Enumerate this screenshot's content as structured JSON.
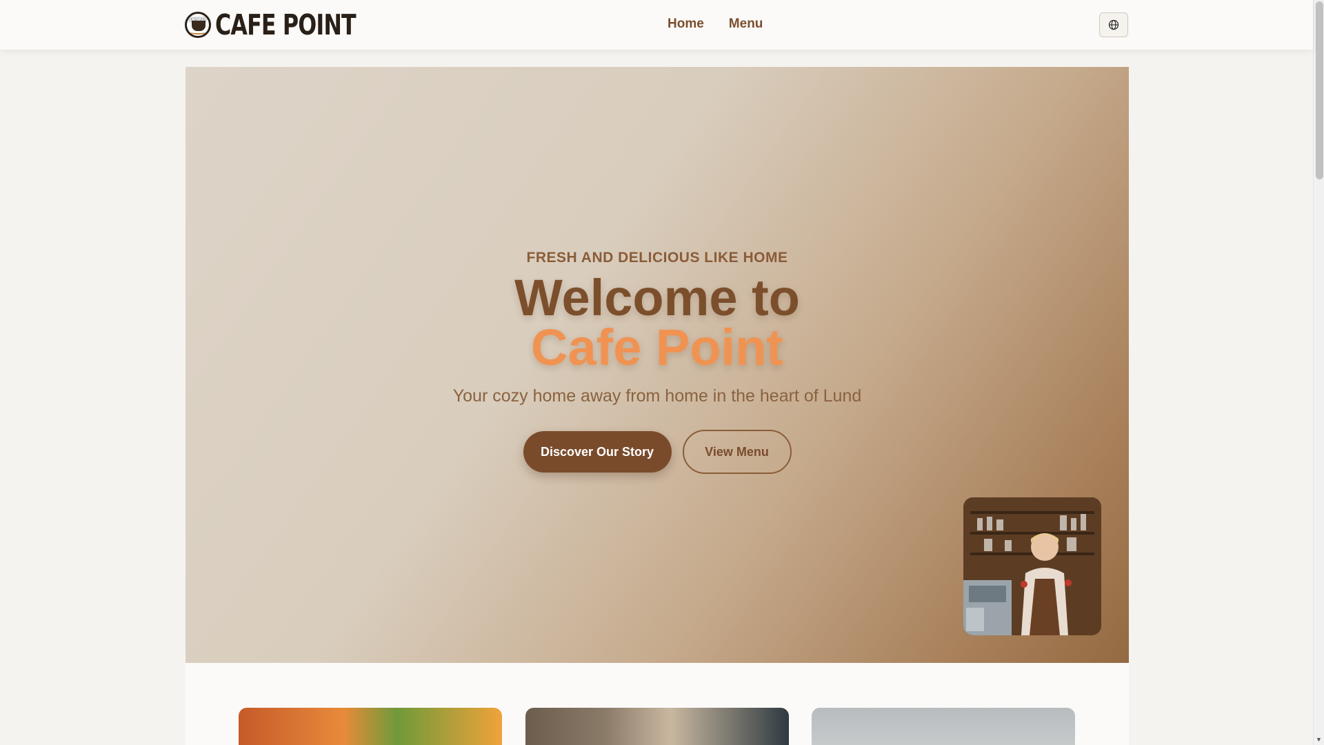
{
  "brand": {
    "name": "CAFE POINT",
    "logo_text": "POINT"
  },
  "nav": {
    "items": [
      "Home",
      "Menu"
    ]
  },
  "language_button": {
    "icon": "globe-icon"
  },
  "hero": {
    "eyebrow": "FRESH AND DELICIOUS LIKE HOME",
    "title_line1": "Welcome to",
    "title_line2": "Cafe Point",
    "tagline": "Your cozy home away from home in the heart of Lund",
    "primary_cta": "Discover Our Story",
    "secondary_cta": "View Menu",
    "photo": "barista-photo"
  },
  "cards": [
    {
      "image": "drink-photo"
    },
    {
      "image": "coffee-photo"
    },
    {
      "image": "dish-photo"
    }
  ],
  "colors": {
    "brand_brown": "#7a4b2b",
    "accent_orange": "#f09352",
    "header_bg": "#fbfaf8"
  }
}
